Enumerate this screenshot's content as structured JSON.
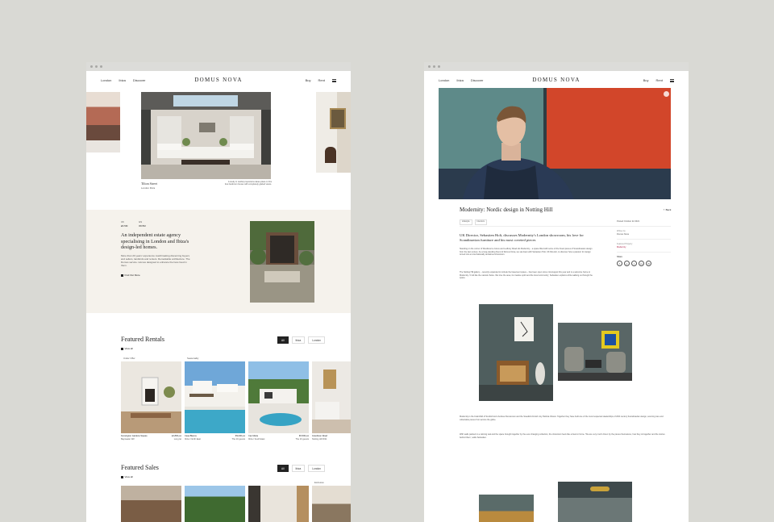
{
  "left": {
    "nav": {
      "links": [
        "London",
        "Ibiza",
        "Discover"
      ],
      "logo": "DOMUS NOVA",
      "right_links": [
        "Buy",
        "Rent"
      ]
    },
    "hero": {
      "title": "Tilton Street",
      "location": "London Ibiza",
      "caption": "A study in restful proportions takes place in this four-bedroom house with completely glazed views."
    },
    "intro": {
      "stat1_label": "UK",
      "stat1_value": "£6.5M",
      "stat2_label": "ES",
      "stat2_value": "€9.5M",
      "heading": "An independent estate agency specialising in London and Ibiza's design-led homes.",
      "body": "More than 20 years' experience matchmaking discerning buyers and sellers, landlords and renters. Remarkable architecture. The Domus service. Homes designed to enhance the lives lived in them.",
      "link": "Find Out More"
    },
    "rentals": {
      "title": "Featured Rentals",
      "view_all": "View all",
      "filters": [
        "All",
        "Ibiza",
        "London"
      ],
      "cards": [
        {
          "tag": "Under Offer",
          "name": "Kensington Gardens Square",
          "area": "Bayswater W2",
          "price": "£2,800 pw",
          "meta": "Long let"
        },
        {
          "tag": "Seasonality",
          "name": "Casa Blanca",
          "area": "Ibiza / North East",
          "price": "€9,000 pw",
          "meta": "The 10 guests"
        },
        {
          "tag": "",
          "name": "Can Maria",
          "area": "Ibiza / South East",
          "price": "€6,500 pw",
          "meta": "The 10 guests"
        },
        {
          "tag": "",
          "name": "Grandison Road",
          "area": "Notting Hill W11",
          "price": "£3,200 pw",
          "meta": ""
        }
      ]
    },
    "sales": {
      "title": "Featured Sales",
      "view_all": "View all",
      "filters": [
        "All",
        "Ibiza",
        "London"
      ],
      "tag": "Exclusive"
    }
  },
  "right": {
    "nav": {
      "links": [
        "London",
        "Ibiza",
        "Discover"
      ],
      "logo": "DOMUS NOVA",
      "right_links": [
        "Buy",
        "Rent"
      ]
    },
    "article": {
      "title": "Modernity: Nordic design in Notting Hill",
      "back": "Back",
      "tags": [
        "Lifestyle",
        "Interiors"
      ],
      "posted_label": "Posted",
      "posted_date": "Posted October 22 2021",
      "author_label": "Written by",
      "author": "Domus Nova",
      "related_label": "Featured Property",
      "related": "Modernity",
      "share_label": "Share",
      "share_icons": [
        "f",
        "p",
        "t",
        "in",
        "✉"
      ],
      "lead": "UK Director, Sebastien Holt, discusses Modernity's London showroom, his love for Scandinavian furniture and his most coveted pieces",
      "p1": "Standing on the corner of Westbourne Grove and Ledbury Road sits Modernity – a space filled with some of the finest pieces of Scandinavian design from the last century. As a long-standing friend of Domus Nova, we sat down with Sebastien Holt, UK Director, to discover how a passion for design turned into an internationally acclaimed showroom.",
      "p2": "The Notting Hill gallery – recently expanded to include the basement space – has been open since mid-August this year and is a welcome home to Modernity. 'It felt like the natural choice. We love the area, its creative spirit and the local community,' Sebastien explains while walking us through the space.",
      "p3": "Modernity is the brainchild of Scottish-born Andrew Duncanson and the Swedish-Finnish Joy Patricia Olsson. Together they have built one of the most respected dealerships of 20th century Scandinavian design, sourcing rare and collectable pieces from across the globe.",
      "p4": "With walls painted in a calming teal and the space brought together by the ever-changing collection, the showroom feels like a lived-in home. 'We are very much driven by the pieces themselves, how they sit together and the stories behind them,' adds Sebastien."
    }
  }
}
